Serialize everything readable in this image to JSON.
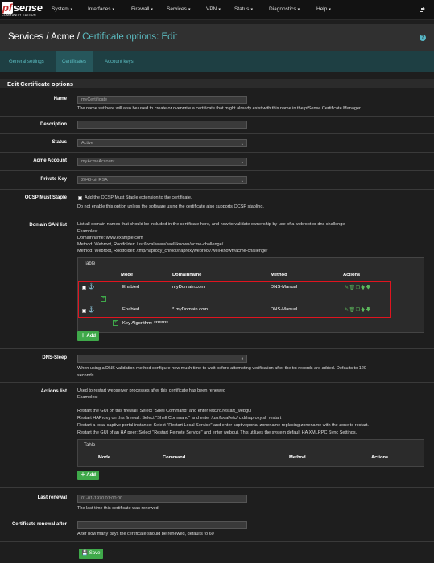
{
  "brand": {
    "pf": "pf",
    "sense": "sense",
    "edition": "COMMUNITY EDITION"
  },
  "nav": [
    "System",
    "Interfaces",
    "Firewall",
    "Services",
    "VPN",
    "Status",
    "Diagnostics",
    "Help"
  ],
  "breadcrumb": {
    "part1": "Services /",
    "part2": "Acme /",
    "current": "Certificate options: Edit"
  },
  "tabs": [
    "General settings",
    "Certificates",
    "Account keys"
  ],
  "panel_title": "Edit Certificate options",
  "name": {
    "label": "Name",
    "value": "myCertificate",
    "help": "The name set here will also be used to create or overwrite a certificate that might already exist with this name in the pfSense Certificate Manager."
  },
  "description": {
    "label": "Description",
    "value": ""
  },
  "status": {
    "label": "Status",
    "value": "Active"
  },
  "acme_account": {
    "label": "Acme Account",
    "value": "myAcmeAccount"
  },
  "private_key": {
    "label": "Private Key",
    "value": "2048-bit RSA"
  },
  "ocsp": {
    "label": "OCSP Must Staple",
    "check_text": "Add the OCSP Must Staple extension to the certificate.",
    "help": "Do not enable this option unless the software using the certificate also supports OCSP stapling."
  },
  "san": {
    "label": "Domain SAN list",
    "intro": "List all domain names that should be included in the certificate here, and how to validate ownership by use of a webroot or dns challenge",
    "examples": "Examples:",
    "ex1": "Domainname: www.example.com",
    "ex2": "Method: Webroot, Rootfolder: /usr/local/www/.well-known/acme-challenge/",
    "ex3": "Method: Webroot, Rootfolder: /tmp/haproxy_chroot/haproxywebroot/.well-known/acme-challenge/",
    "table_title": "Table",
    "headers": [
      "Mode",
      "Domainname",
      "Method",
      "Actions"
    ],
    "rows": [
      {
        "mode": "Enabled",
        "domain": "myDomain.com",
        "method": "DNS-Manual"
      },
      {
        "mode": "Enabled",
        "domain": "*.myDomain.com",
        "method": "DNS-Manual"
      }
    ],
    "key_algo": "Key Algorithm: ********",
    "add": "Add"
  },
  "dns_sleep": {
    "label": "DNS-Sleep",
    "help1": "When using a DNS validation method configure how much time to wait before attempting verification after the txt records are added. Defaults to 120",
    "help2": "seconds."
  },
  "actions": {
    "label": "Actions list",
    "l1": "Used to restart webserver processes after this certificate has been renewed",
    "l2": "Examples:",
    "l3": "Restart the GUI on this firewall: Select \"Shell Command\" and enter /etc/rc.restart_webgui",
    "l4": "Restart HAProxy on this firewall: Select \"Shell Command\" and enter /usr/local/etc/rc.d/haproxy.sh restart",
    "l5": "Restart a local captive portal instance: Select \"Restart Local Service\" and enter captiveportal zonename replacing zonename with the zone to restart.",
    "l6": "Restart the GUI of an HA peer: Select \"Restart Remote Service\" and enter webgui. This utilizes the system default HA XMLRPC Sync Settings.",
    "table_title": "Table",
    "headers": [
      "Mode",
      "Command",
      "Method",
      "Actions"
    ],
    "add": "Add"
  },
  "last_renewal": {
    "label": "Last renewal",
    "value": "01-01-1970 01:00:00",
    "help": "The last time this certificate was renewed"
  },
  "renewal_after": {
    "label": "Certificate renewal after",
    "value": "",
    "help": "After how many days the certificate should be renewed, defaults to 60"
  },
  "save": "Save"
}
